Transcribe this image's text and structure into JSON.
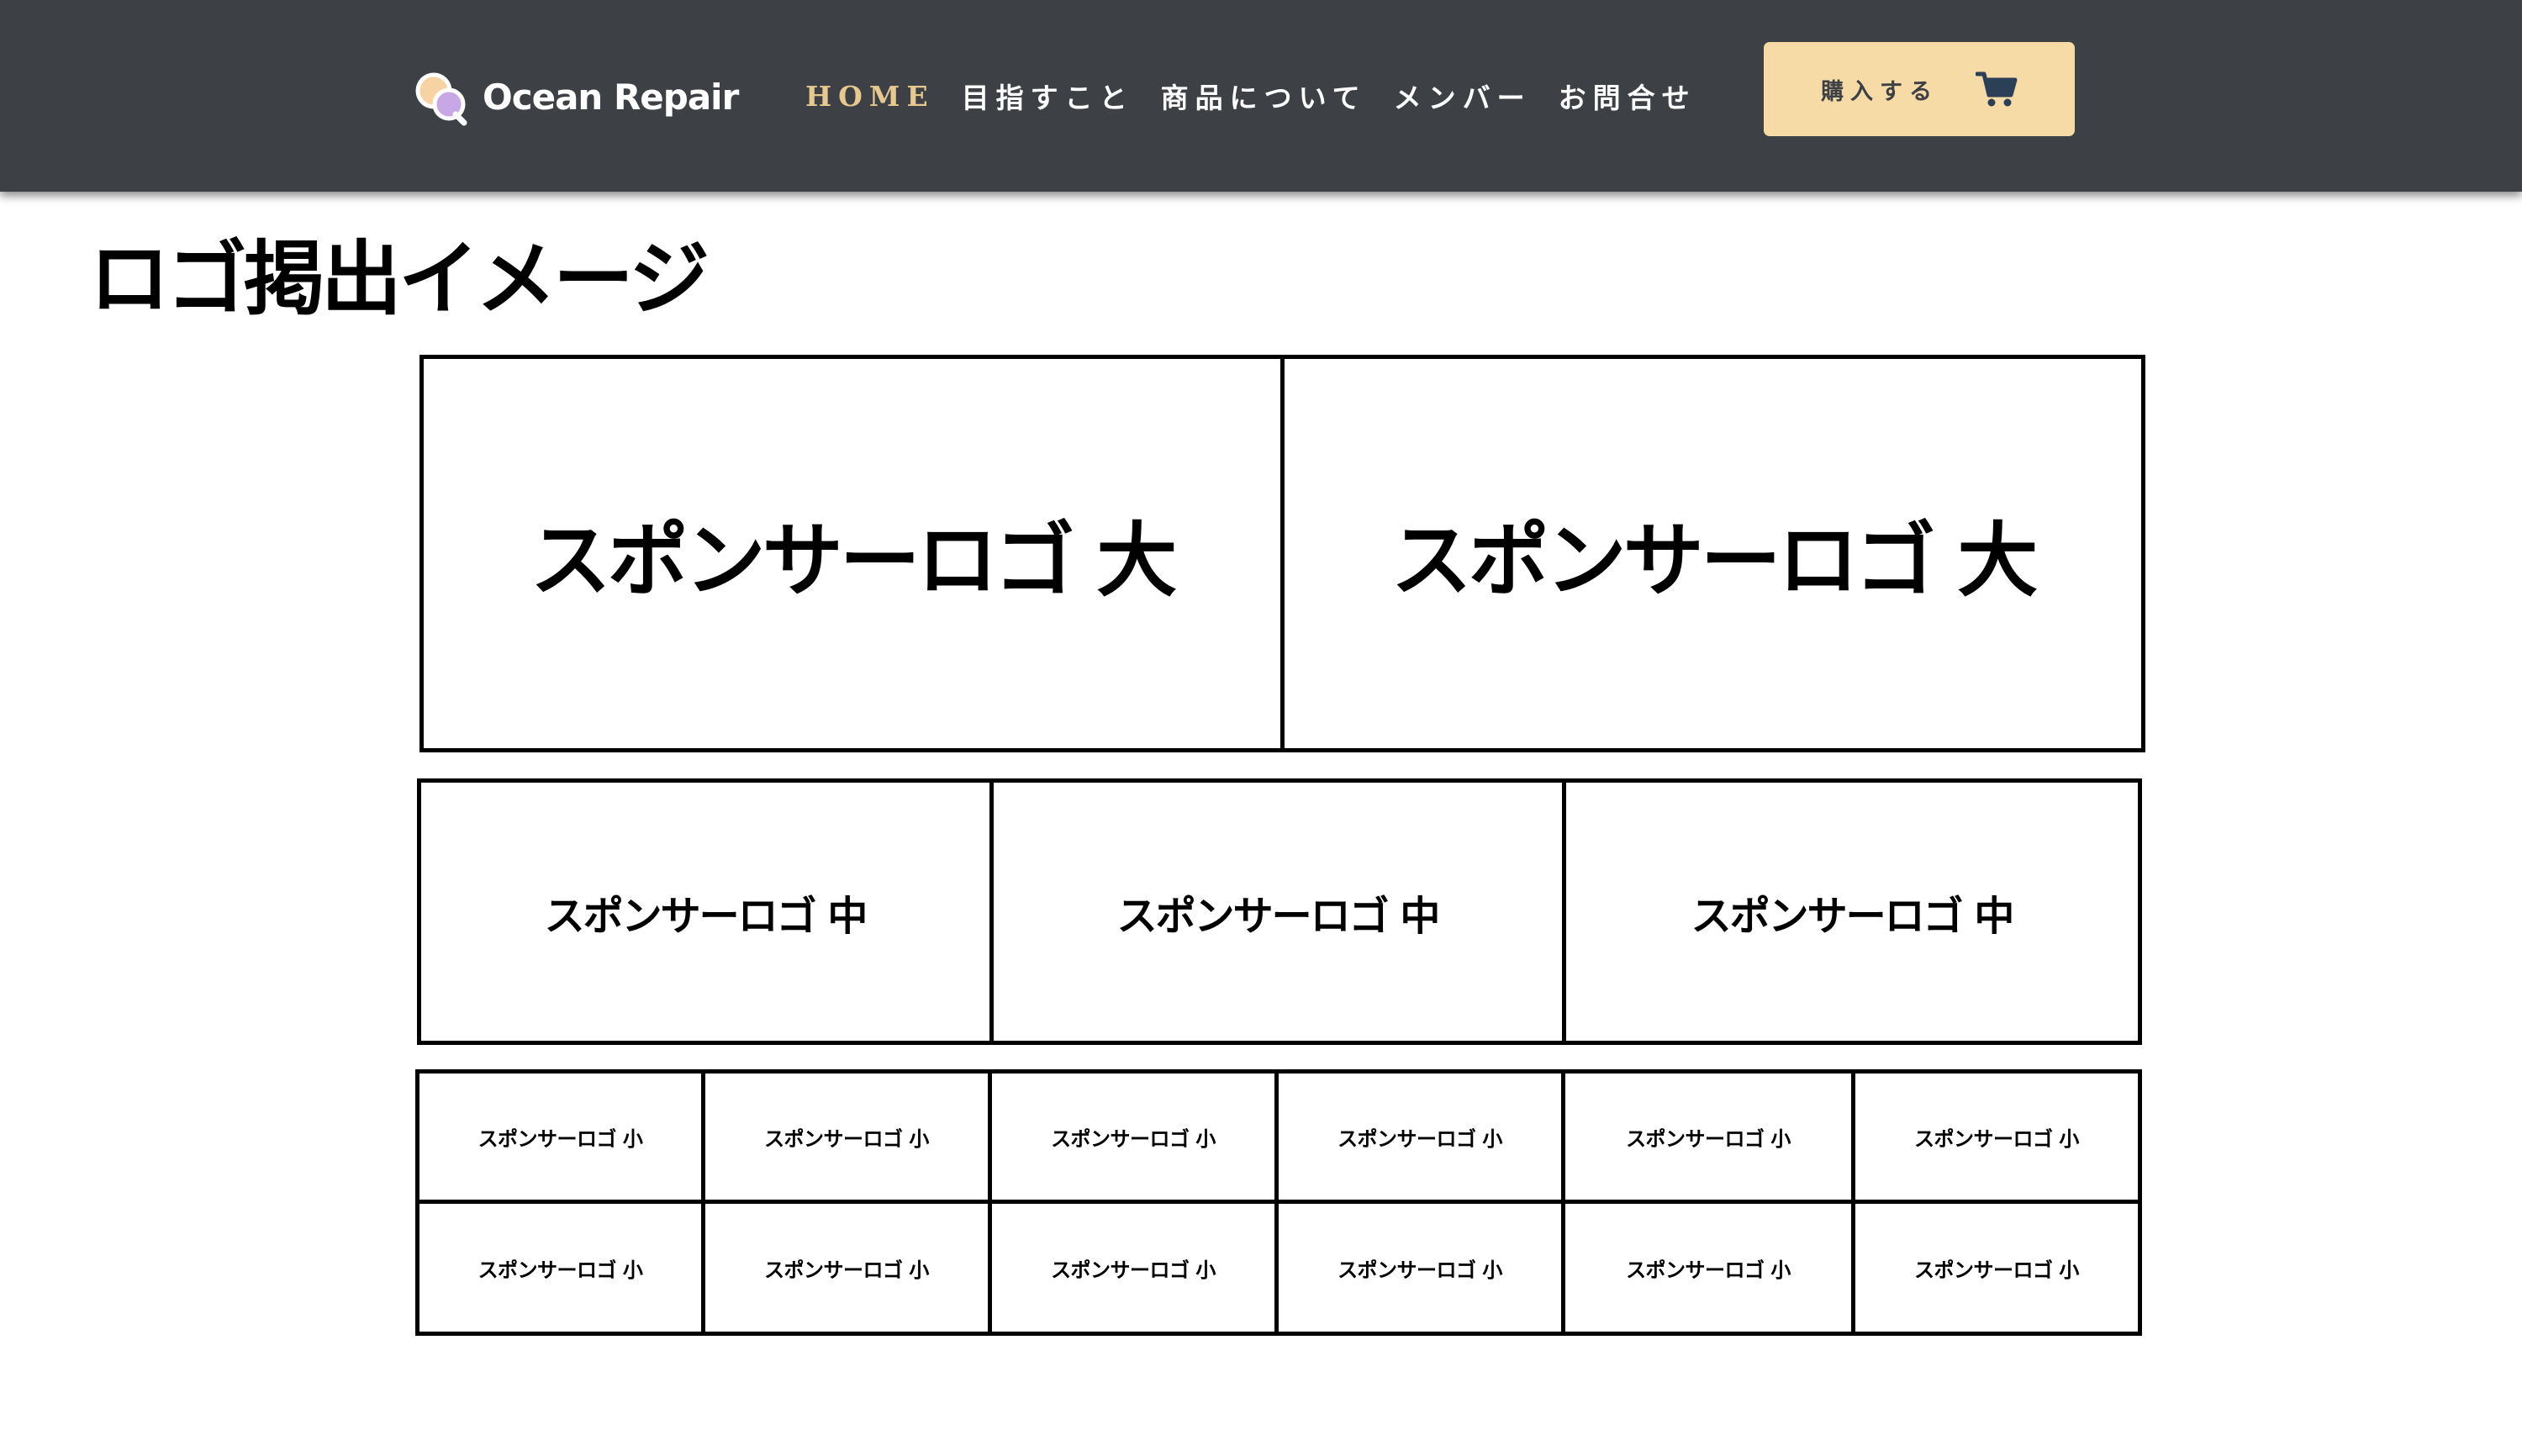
{
  "header": {
    "brand": "Ocean Repair",
    "nav": [
      "HOME",
      "目指すこと",
      "商品について",
      "メンバー",
      "お問合せ"
    ],
    "active_nav": "HOME",
    "buy_label": "購入する",
    "colors": {
      "header_bg": "#3d4145",
      "nav_active": "#e7c88e",
      "nav_text": "#ffffff",
      "buy_button_bg": "#f7dba6",
      "cart_icon": "#2b3f56"
    },
    "icons": [
      "ocean-repair-logo-icon",
      "cart-icon"
    ]
  },
  "page": {
    "title": "ロゴ掲出イメージ"
  },
  "sponsors": {
    "large": [
      "スポンサーロゴ 大",
      "スポンサーロゴ 大"
    ],
    "medium": [
      "スポンサーロゴ 中",
      "スポンサーロゴ 中",
      "スポンサーロゴ 中"
    ],
    "small": [
      "スポンサーロゴ 小",
      "スポンサーロゴ 小",
      "スポンサーロゴ 小",
      "スポンサーロゴ 小",
      "スポンサーロゴ 小",
      "スポンサーロゴ 小",
      "スポンサーロゴ 小",
      "スポンサーロゴ 小",
      "スポンサーロゴ 小",
      "スポンサーロゴ 小",
      "スポンサーロゴ 小",
      "スポンサーロゴ 小"
    ]
  }
}
